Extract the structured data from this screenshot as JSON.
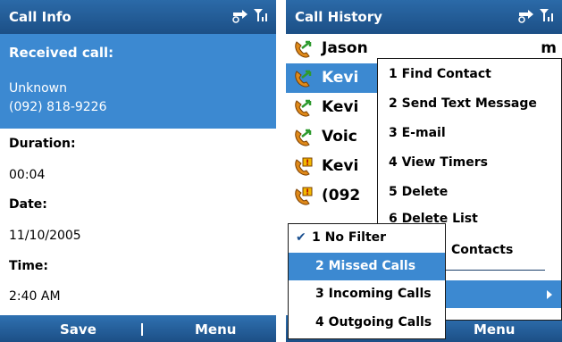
{
  "left": {
    "title": "Call Info",
    "received_heading": "Received call:",
    "caller_name": "Unknown",
    "caller_number": "(092) 818-9226",
    "duration_label": "Duration:",
    "duration_value": "00:04",
    "date_label": "Date:",
    "date_value": "11/10/2005",
    "time_label": "Time:",
    "time_value": "2:40 AM",
    "softkeys": {
      "left": "Save",
      "right": "Menu"
    }
  },
  "right": {
    "title": "Call History",
    "rows": [
      {
        "name": "Jason",
        "trail": "m",
        "icon": "incoming-call-icon"
      },
      {
        "name": "Kevi",
        "icon": "incoming-call-icon"
      },
      {
        "name": "Kevi",
        "icon": "incoming-call-icon"
      },
      {
        "name": "Voic",
        "icon": "incoming-call-icon"
      },
      {
        "name": "Kevi",
        "icon": "missed-call-icon"
      },
      {
        "name": "(092",
        "icon": "missed-call-icon"
      }
    ],
    "menu_items": [
      "1 Find Contact",
      "2 Send Text Message",
      "3 E-mail",
      "4 View Timers",
      "5 Delete",
      "6 Delete List",
      "Contacts"
    ],
    "filter_items": [
      "1 No Filter",
      "2 Missed Calls",
      "3 Incoming Calls",
      "4 Outgoing Calls"
    ],
    "filter_checked_index": 0,
    "filter_highlighted_index": 1,
    "softkey_right": "Menu"
  },
  "colors": {
    "title_bar": "#1c4f86",
    "selection": "#3c89d1",
    "missed_icon": "#f2b800",
    "incoming_icon": "#2e9a2e"
  }
}
